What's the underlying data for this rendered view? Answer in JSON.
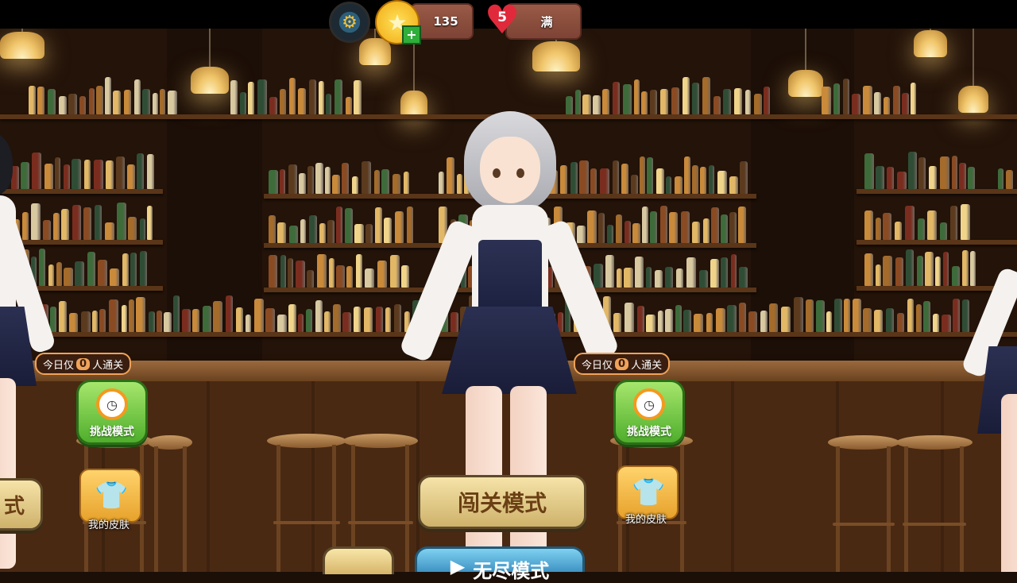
{
  "hud": {
    "settings_icon": "gear-icon",
    "coins_icon": "star-coin-icon",
    "coins_value": "135",
    "add_icon": "plus-icon",
    "hearts_icon": "heart-icon",
    "hearts_count": "5",
    "hearts_status": "满"
  },
  "challenges": [
    {
      "bubble_prefix": "今日仅",
      "bubble_count": "0",
      "bubble_suffix": "人通关",
      "button_label": "挑战模式",
      "button_icon": "alarm-clock-icon"
    },
    {
      "bubble_prefix": "今日仅",
      "bubble_count": "0",
      "bubble_suffix": "人通关",
      "button_label": "挑战模式",
      "button_icon": "alarm-clock-icon"
    }
  ],
  "skins": [
    {
      "label": "我的皮肤",
      "icon": "tshirt-icon"
    },
    {
      "label": "我的皮肤",
      "icon": "tshirt-icon"
    }
  ],
  "left_mode_partial": "式",
  "main_mode": "闯关模式",
  "endless_mode": "无尽模式",
  "endless_icon": "play-icon",
  "colors": {
    "hud_pill": "#8a4c3c",
    "challenge_green": "#6cc43a",
    "mode_gold": "#e6cf8a",
    "endless_blue": "#5ab3dd"
  }
}
